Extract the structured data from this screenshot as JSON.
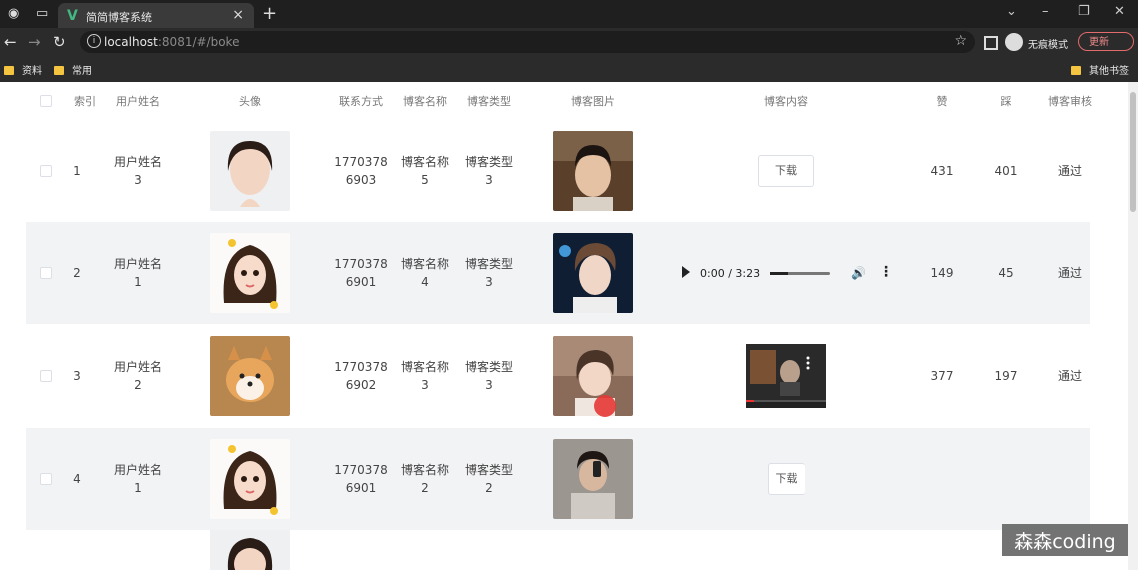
{
  "browser": {
    "tab_title": "简简博客系统",
    "url_host": "localhost",
    "url_path": ":8081/#/boke",
    "incognito_label": "无痕模式",
    "update_label": "更新",
    "bookmarks": [
      "资料",
      "常用"
    ],
    "other_bookmarks": "其他书签"
  },
  "table": {
    "headers": [
      "索引",
      "用户姓名",
      "头像",
      "联系方式",
      "博客名称",
      "博客类型",
      "博客图片",
      "博客内容",
      "赞",
      "踩",
      "博客审核"
    ],
    "rows": [
      {
        "index": "1",
        "name_a": "用户姓名",
        "name_b": "3",
        "phone_a": "1770378",
        "phone_b": "6903",
        "title_a": "博客名称",
        "title_b": "5",
        "type_a": "博客类型",
        "type_b": "3",
        "content": "下载",
        "likes": "431",
        "dislikes": "401",
        "status": "通过"
      },
      {
        "index": "2",
        "name_a": "用户姓名",
        "name_b": "1",
        "phone_a": "1770378",
        "phone_b": "6901",
        "title_a": "博客名称",
        "title_b": "4",
        "type_a": "博客类型",
        "type_b": "3",
        "audio_time": "0:00 / 3:23",
        "likes": "149",
        "dislikes": "45",
        "status": "通过"
      },
      {
        "index": "3",
        "name_a": "用户姓名",
        "name_b": "2",
        "phone_a": "1770378",
        "phone_b": "6902",
        "title_a": "博客名称",
        "title_b": "3",
        "type_a": "博客类型",
        "type_b": "3",
        "likes": "377",
        "dislikes": "197",
        "status": "通过"
      },
      {
        "index": "4",
        "name_a": "用户姓名",
        "name_b": "1",
        "phone_a": "1770378",
        "phone_b": "6901",
        "title_a": "博客名称",
        "title_b": "2",
        "type_a": "博客类型",
        "type_b": "2",
        "content": "下载",
        "likes": "",
        "dislikes": "",
        "status": ""
      }
    ]
  },
  "watermark": "森森coding"
}
